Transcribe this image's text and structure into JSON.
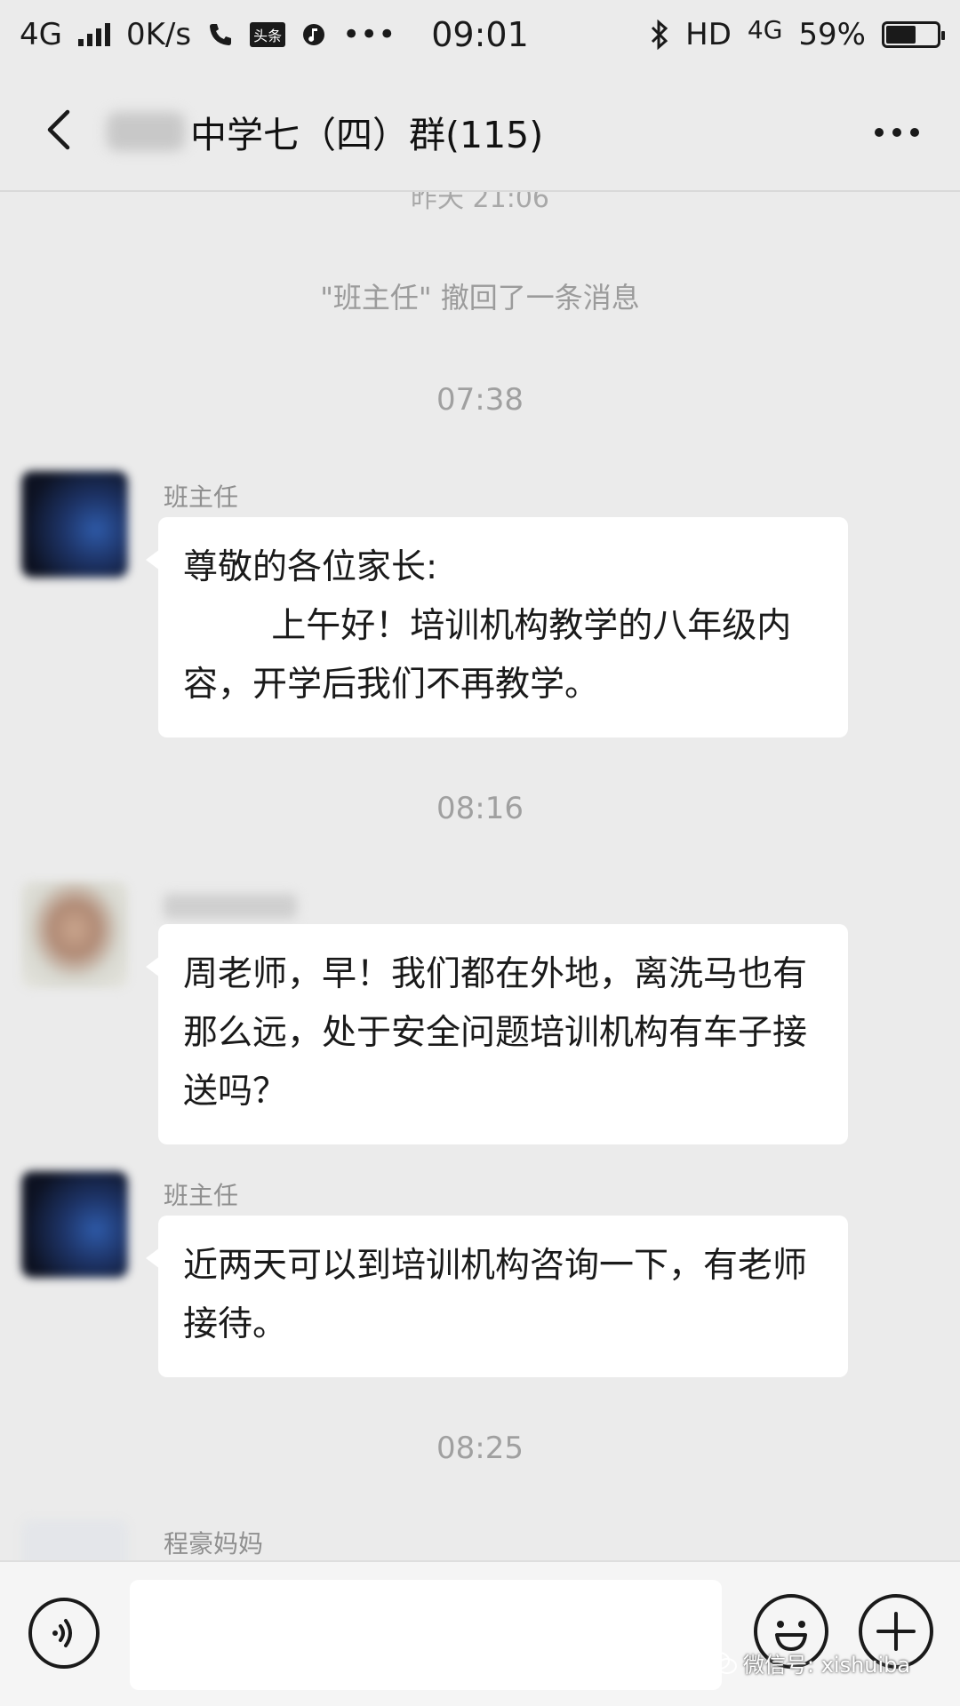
{
  "status_bar": {
    "network": "4G",
    "speed": "0K/s",
    "app_badge": "头条",
    "more": "•••",
    "time": "09:01",
    "hd": "HD",
    "network_right": "4G",
    "battery": "59%",
    "battery_level": 0.59
  },
  "header": {
    "title": "中学七（四）群(115)"
  },
  "chat": {
    "clipped_timestamp": "昨天 21:06",
    "system_message": "\"班主任\" 撤回了一条消息",
    "messages": [
      {
        "timestamp": "07:38",
        "sender": "班主任",
        "text": "尊敬的各位家长:\n        上午好！培训机构教学的八年级内容，开学后我们不再教学。"
      },
      {
        "timestamp": "08:16",
        "sender": "",
        "text": "周老师，早！我们都在外地，离洗马也有那么远，处于安全问题培训机构有车子接送吗？"
      },
      {
        "timestamp": "",
        "sender": "班主任",
        "text": "近两天可以到培训机构咨询一下，有老师接待。"
      },
      {
        "timestamp": "08:25",
        "sender": "程豪妈妈",
        "text": ""
      }
    ]
  },
  "input_bar": {
    "placeholder": ""
  },
  "watermark": {
    "text": "微信号: xishuiba"
  }
}
